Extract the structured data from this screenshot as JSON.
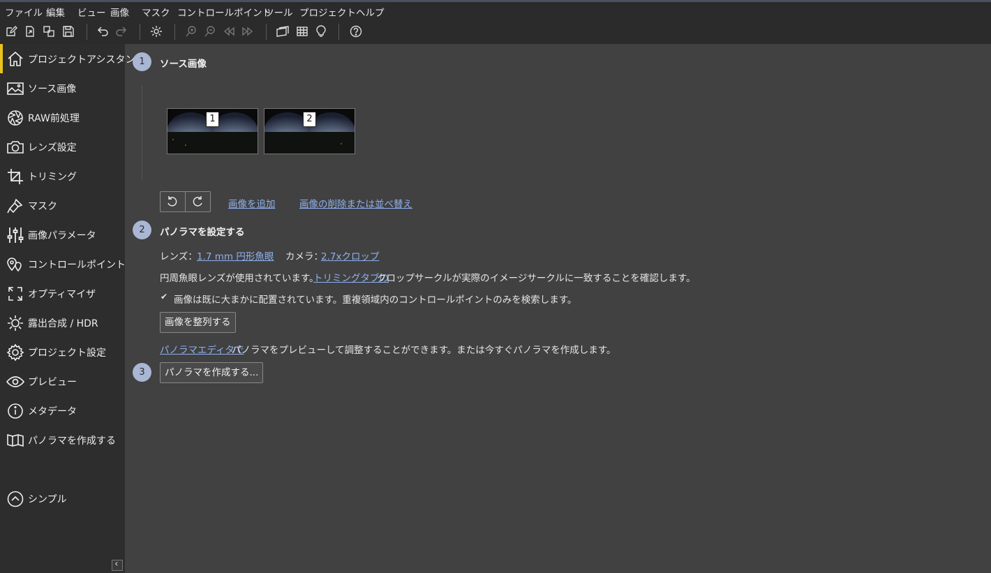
{
  "menu": [
    "ファイル",
    "編集",
    "ビュー",
    "画像",
    "マスク",
    "コントロールポイント",
    "ツール",
    "プロジェクト",
    "ヘルプ"
  ],
  "toolbar": {
    "icons": [
      "new-project-icon",
      "open-icon",
      "copy-icon",
      "save-icon",
      "undo-icon",
      "redo-icon",
      "settings-icon",
      "zoom-in-icon",
      "zoom-out-icon",
      "prev-icon",
      "next-icon",
      "panorama-editor-icon",
      "grid-icon",
      "lightbulb-icon",
      "help-icon"
    ]
  },
  "sidebar": {
    "items": [
      {
        "label": "プロジェクトアシスタント",
        "icon": "home-icon"
      },
      {
        "label": "ソース画像",
        "icon": "image-icon"
      },
      {
        "label": "RAW前処理",
        "icon": "aperture-icon"
      },
      {
        "label": "レンズ設定",
        "icon": "camera-icon"
      },
      {
        "label": "トリミング",
        "icon": "crop-icon"
      },
      {
        "label": "マスク",
        "icon": "brush-icon"
      },
      {
        "label": "画像パラメータ",
        "icon": "sliders-icon"
      },
      {
        "label": "コントロールポイント",
        "icon": "pin-icon"
      },
      {
        "label": "オプティマイザ",
        "icon": "optimize-icon"
      },
      {
        "label": "露出合成 / HDR",
        "icon": "sun-icon"
      },
      {
        "label": "プロジェクト設定",
        "icon": "gear-icon"
      },
      {
        "label": "プレビュー",
        "icon": "eye-icon"
      },
      {
        "label": "メタデータ",
        "icon": "info-icon"
      },
      {
        "label": "パノラマを作成する",
        "icon": "panorama-icon"
      }
    ],
    "simple_label": "シンプル",
    "collapse_label": "‹"
  },
  "step1": {
    "number": "1",
    "title": "ソース画像",
    "thumbnails": [
      "1",
      "2"
    ],
    "add_link": "画像を追加",
    "remove_link": "画像の削除または並べ替え"
  },
  "step2": {
    "number": "2",
    "title": "パノラマを設定する",
    "lens_label": "レンズ：",
    "lens_value": "1.7 mm 円形魚眼",
    "camera_label": "カメラ：",
    "camera_value": "2.7xクロップ",
    "info_prefix": "円周魚眼レンズが使用されています。",
    "info_link": "トリミングタブの",
    "info_suffix": "クロップサークルが実際のイメージサークルに一致することを確認します。",
    "checkbox_checked": true,
    "checkbox_mark": "✔",
    "checkbox_label": "画像は既に大まかに配置されています。重複領域内のコントロールポイントのみを検索します。",
    "align_button": "画像を整列する",
    "editor_link": "パノラマエディタで",
    "editor_suffix": "パノラマをプレビューして調整することができます。または今すぐパノラマを作成します。"
  },
  "step3": {
    "number": "3",
    "create_button": "パノラマを作成する..."
  }
}
